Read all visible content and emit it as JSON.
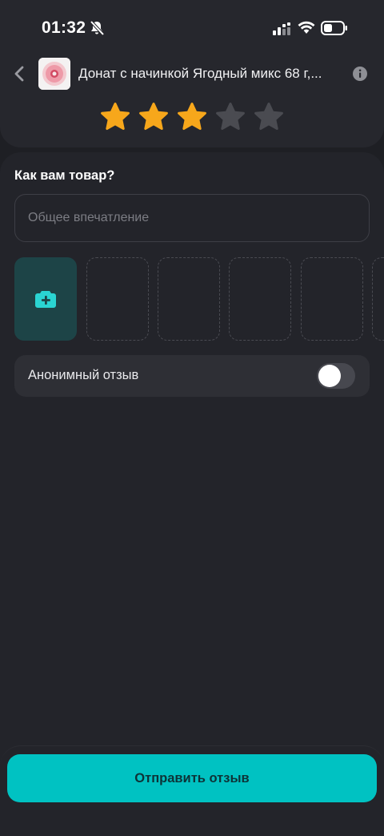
{
  "status_bar": {
    "time": "01:32",
    "icons": [
      "bell-slash-icon",
      "signal-icon",
      "wifi-icon",
      "battery-icon"
    ]
  },
  "header": {
    "back_icon": "chevron-left-icon",
    "product_title": "Донат с начинкой Ягодный микс 68 г,...",
    "info_icon": "info-icon"
  },
  "rating": {
    "value": 3,
    "max": 5,
    "colors": {
      "active": "#f7a71b",
      "inactive": "#4a4b51"
    }
  },
  "form": {
    "question": "Как вам товар?",
    "impression_placeholder": "Общее впечатление",
    "impression_value": "",
    "add_photo_icon": "camera-plus-icon",
    "anonymous_label": "Анонимный отзыв",
    "anonymous_enabled": false
  },
  "footer": {
    "submit_label": "Отправить отзыв"
  },
  "colors": {
    "accent": "#00c2c2",
    "background": "#1e1f24",
    "card": "#26272d"
  }
}
